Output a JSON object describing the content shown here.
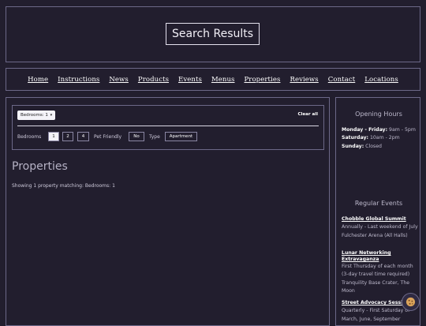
{
  "header": {
    "title": "Search Results"
  },
  "nav": {
    "items": [
      "Home",
      "Instructions",
      "News",
      "Products",
      "Events",
      "Menus",
      "Properties",
      "Reviews",
      "Contact",
      "Locations"
    ]
  },
  "filters": {
    "bedrooms_select": "Bedrooms: 1",
    "clear_all": "Clear all",
    "bedrooms_label": "Bedrooms",
    "bedroom_options": [
      "1",
      "2",
      "4"
    ],
    "bedrooms_selected": "1",
    "pet_label": "Pet Friendly",
    "pet_value": "No",
    "type_label": "Type",
    "type_value": "Apartment"
  },
  "main": {
    "heading": "Properties",
    "count_text": "Showing 1 property matching: Bedrooms: 1"
  },
  "sidebar": {
    "hours_heading": "Opening Hours",
    "hours": [
      {
        "day": "Monday - Friday:",
        "time": "9am - 5pm"
      },
      {
        "day": "Saturday:",
        "time": "10am - 2pm"
      },
      {
        "day": "Sunday:",
        "time": "Closed"
      }
    ],
    "events_heading": "Regular Events",
    "events": [
      {
        "title": "Chobble Global Summit",
        "lines": [
          "Annually - Last weekend of July",
          "Fulchester Arena (All Halls)"
        ]
      },
      {
        "title": "Lunar Networking Extravaganza",
        "lines": [
          "First Thursday of each month (3-day travel time required)",
          "Tranquility Base Crater, The Moon"
        ]
      },
      {
        "title": "Street Advocacy Session",
        "lines": [
          "Quarterly - First Saturday of March, June, September"
        ]
      }
    ]
  },
  "icons": {
    "cookie": "cookie-icon",
    "dropdown": "chevron-down-icon"
  },
  "colors": {
    "background": "#221e2e",
    "border": "#6c6888"
  }
}
